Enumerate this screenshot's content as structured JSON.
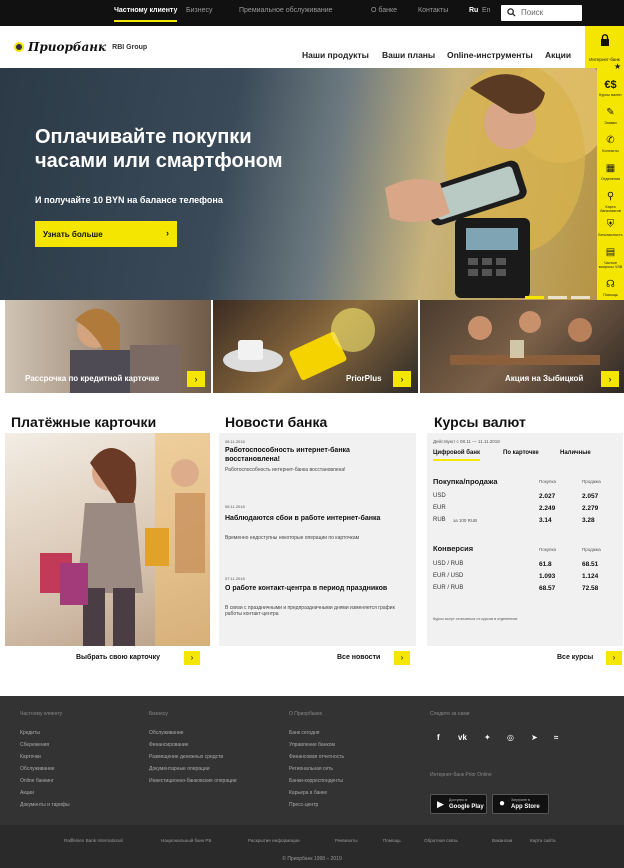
{
  "topbar": {
    "tabs": [
      "Частному клиенту",
      "Бизнесу",
      "Премиальное обслуживание"
    ],
    "links": [
      "О банке",
      "Контакты"
    ],
    "languages": [
      "Ru",
      "En"
    ],
    "search_placeholder": "Поиск"
  },
  "header": {
    "brand": "Приорбанк",
    "group": "RBI Group",
    "nav": [
      "Наши продукты",
      "Ваши планы",
      "Online-инструменты",
      "Акции"
    ],
    "internet_bank": "Интернет-банк"
  },
  "sidebar": {
    "items": [
      "Курсы валют",
      "Заявки",
      "Контакты",
      "Отделения",
      "Карта банкоматов",
      "Безопасность",
      "Частые вопросы ЧЗВ",
      "Помощь"
    ]
  },
  "hero": {
    "title_line1": "Оплачивайте покупки",
    "title_line2": "часами или смартфоном",
    "subtitle": "И получайте 10 BYN на балансе телефона",
    "button": "Узнать больше"
  },
  "promos": [
    {
      "caption": "Рассрочка по кредитной карточке"
    },
    {
      "caption": "PriorPlus"
    },
    {
      "caption": "Акция на Зыбицкой"
    }
  ],
  "cards": {
    "title": "Платёжные карточки",
    "link": "Выбрать свою карточку"
  },
  "news": {
    "title": "Новости банка",
    "items": [
      {
        "date": "08.11.2018",
        "title": "Работоспособность интернет-банка восстановлена!",
        "text": "Работоспособность интернет-банка восстановлена!"
      },
      {
        "date": "08.11.2018",
        "title": "Наблюдаются сбои в работе интернет-банка",
        "text": "Временно недоступны некоторые операции по карточкам"
      },
      {
        "date": "07.11.2018",
        "title": "О работе контакт-центра в период праздников",
        "text": "В связи с праздничными и предпраздничными днями изменяется график работы контакт-центра"
      }
    ],
    "link": "Все новости"
  },
  "rates": {
    "title": "Курсы валют",
    "updated": "Действуют с 08.11 — 11.11.2018",
    "tabs": [
      "Цифровой банк",
      "По карточке",
      "Наличные"
    ],
    "buy_sell": {
      "heading": "Покупка/продажа",
      "cols": [
        "Покупка",
        "Продажа"
      ],
      "rows": [
        {
          "cur": "USD",
          "buy": "2.027",
          "sell": "2.057"
        },
        {
          "cur": "EUR",
          "buy": "2.249",
          "sell": "2.279"
        },
        {
          "cur": "RUB",
          "note": "за 100 RUB",
          "buy": "3.14",
          "sell": "3.28"
        }
      ]
    },
    "conversion": {
      "heading": "Конверсия",
      "cols": [
        "Покупка",
        "Продажа"
      ],
      "rows": [
        {
          "cur": "USD / RUB",
          "buy": "61.8",
          "sell": "68.51"
        },
        {
          "cur": "EUR / USD",
          "buy": "1.093",
          "sell": "1.124"
        },
        {
          "cur": "EUR / RUB",
          "buy": "68.57",
          "sell": "72.58"
        }
      ]
    },
    "note": "Курсы могут отличаться от курсов в отделениях",
    "link": "Все курсы"
  },
  "footer": {
    "col1": {
      "head": "Частному клиенту",
      "items": [
        "Кредиты",
        "Сбережения",
        "Карточки",
        "Обслуживание",
        "Online банкинг",
        "Акции",
        "Документы и тарифы"
      ]
    },
    "col2": {
      "head": "Бизнесу",
      "items": [
        "Обслуживание",
        "Финансирование",
        "Размещение денежных средств",
        "Документарные операции",
        "Инвестиционно-банковские операции"
      ]
    },
    "col3": {
      "head": "О Приорбанке",
      "items": [
        "Банк сегодня",
        "Управление банком",
        "Финансовая отчетность",
        "Региональная сеть",
        "Банки-корреспонденты",
        "Карьера в банке",
        "Пресс-центр"
      ]
    },
    "col4": {
      "head": "Следите за нами",
      "apps_head": "Интернет-банк Prior Online"
    },
    "social": [
      "f",
      "vk",
      "tw",
      "ig",
      "tg",
      "rss"
    ],
    "stores": [
      {
        "small": "Доступно в",
        "big": "Google Play"
      },
      {
        "small": "Загрузите в",
        "big": "App Store"
      }
    ],
    "bottom_links": [
      "Raiffeisen Bank International",
      "Национальный банк РБ",
      "Раскрытие информации",
      "Реквизиты",
      "Помощь",
      "Обратная связь",
      "Вакансии",
      "Карта сайта"
    ],
    "copyright": "© Приорбанк 1998 – 2019"
  }
}
